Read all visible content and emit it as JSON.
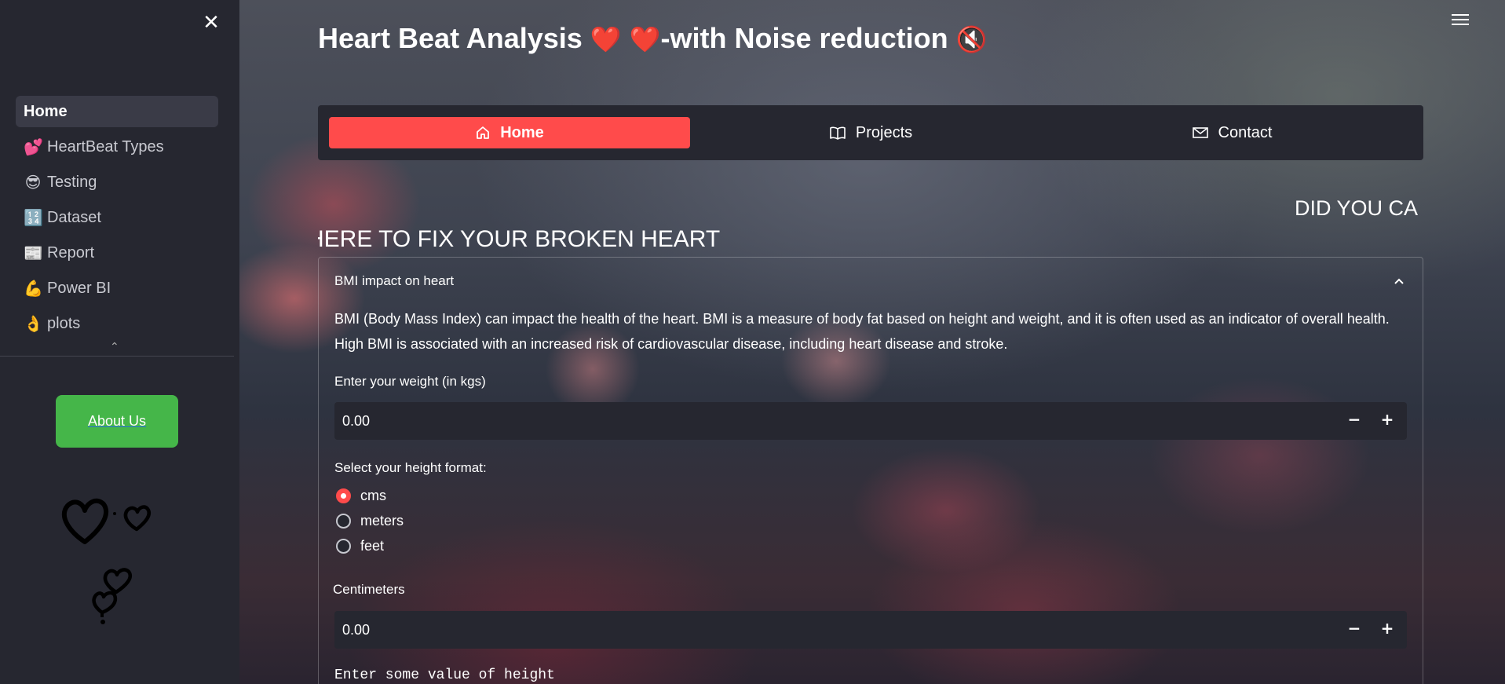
{
  "sidebar": {
    "close_icon": "close-icon",
    "items": [
      {
        "label": "Home",
        "emoji": "",
        "active": true
      },
      {
        "label": "HeartBeat Types",
        "emoji": "💕"
      },
      {
        "label": "Testing",
        "emoji": "😎"
      },
      {
        "label": "Dataset",
        "emoji": "🔢"
      },
      {
        "label": "Report",
        "emoji": "📰"
      },
      {
        "label": "Power BI",
        "emoji": "💪"
      },
      {
        "label": "plots",
        "emoji": "👌"
      }
    ],
    "about_button": "About Us"
  },
  "header": {
    "title": "Heart Beat Analysis",
    "title_emoji_1": "❤️",
    "title_emoji_2": "❤️",
    "title_suffix": "-with Noise reduction",
    "title_emoji_3": "🔇"
  },
  "topnav": {
    "items": [
      {
        "label": "Home",
        "icon": "house-icon",
        "active": true
      },
      {
        "label": "Projects",
        "icon": "book-icon"
      },
      {
        "label": "Contact",
        "icon": "envelope-icon"
      }
    ]
  },
  "marquee": {
    "line1": "DID YOU CA",
    "line2": "HERE TO FIX YOUR BROKEN HEART"
  },
  "expander": {
    "title": "BMI impact on heart",
    "description": "BMI (Body Mass Index) can impact the health of the heart. BMI is a measure of body fat based on height and weight, and it is often used as an indicator of overall health. High BMI is associated with an increased risk of cardiovascular disease, including heart disease and stroke.",
    "weight_label": "Enter your weight (in kgs)",
    "weight_value": "0.00",
    "height_format_label": "Select your height format:",
    "height_options": [
      "cms",
      "meters",
      "feet"
    ],
    "height_selected": "cms",
    "cm_label": "Centimeters",
    "cm_value": "0.00",
    "height_message": "Enter some value of height",
    "minus": "−",
    "plus": "+"
  },
  "colors": {
    "accent": "#ff4b4b",
    "sidebar_bg": "#262730",
    "about_button": "#45b649"
  }
}
